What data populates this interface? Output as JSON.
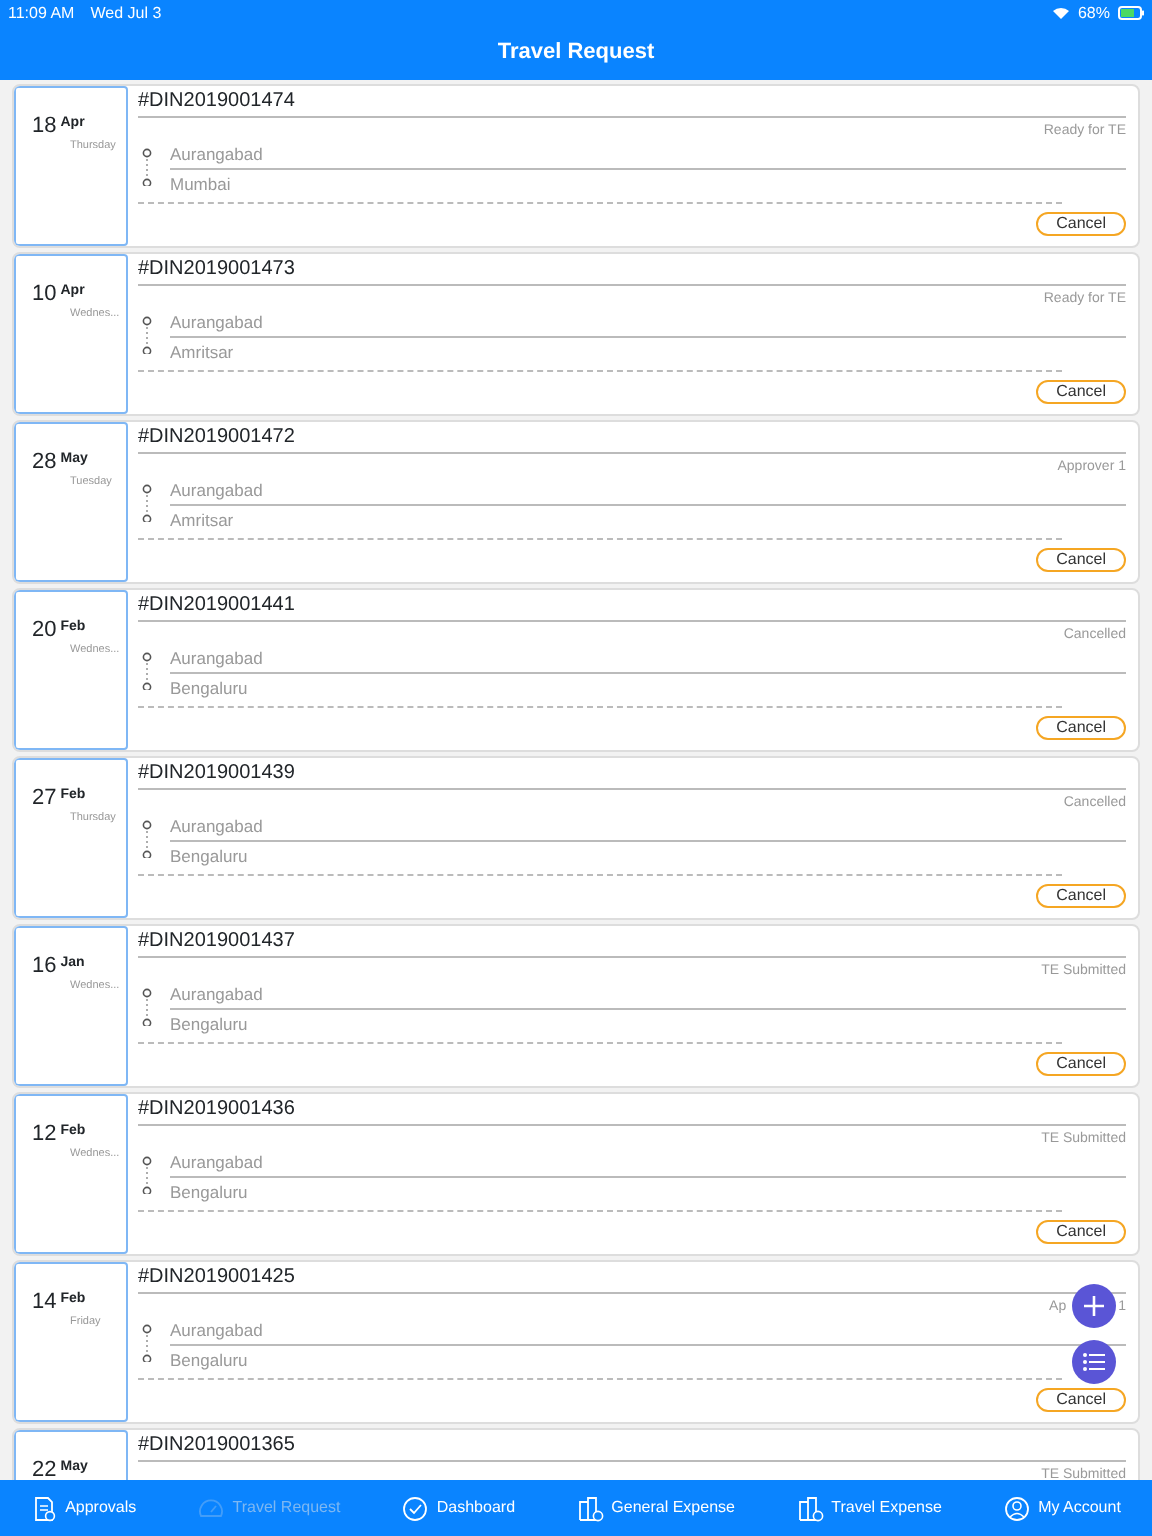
{
  "status_bar": {
    "time": "11:09 AM",
    "date": "Wed Jul 3",
    "battery": "68%"
  },
  "header": {
    "title": "Travel Request"
  },
  "requests": [
    {
      "day": "18",
      "month": "Apr",
      "weekday": "Thursday",
      "id": "#DIN2019001474",
      "status": "Ready for TE",
      "from": "Aurangabad",
      "to": "Mumbai",
      "action": "Cancel"
    },
    {
      "day": "10",
      "month": "Apr",
      "weekday": "Wednes...",
      "id": "#DIN2019001473",
      "status": "Ready for TE",
      "from": "Aurangabad",
      "to": "Amritsar",
      "action": "Cancel"
    },
    {
      "day": "28",
      "month": "May",
      "weekday": "Tuesday",
      "id": "#DIN2019001472",
      "status": "Approver 1",
      "from": "Aurangabad",
      "to": "Amritsar",
      "action": "Cancel"
    },
    {
      "day": "20",
      "month": "Feb",
      "weekday": "Wednes...",
      "id": "#DIN2019001441",
      "status": "Cancelled",
      "from": "Aurangabad",
      "to": "Bengaluru",
      "action": "Cancel"
    },
    {
      "day": "27",
      "month": "Feb",
      "weekday": "Thursday",
      "id": "#DIN2019001439",
      "status": "Cancelled",
      "from": "Aurangabad",
      "to": "Bengaluru",
      "action": "Cancel"
    },
    {
      "day": "16",
      "month": "Jan",
      "weekday": "Wednes...",
      "id": "#DIN2019001437",
      "status": "TE Submitted",
      "from": "Aurangabad",
      "to": "Bengaluru",
      "action": "Cancel"
    },
    {
      "day": "12",
      "month": "Feb",
      "weekday": "Wednes...",
      "id": "#DIN2019001436",
      "status": "TE Submitted",
      "from": "Aurangabad",
      "to": "Bengaluru",
      "action": "Cancel"
    },
    {
      "day": "14",
      "month": "Feb",
      "weekday": "Friday",
      "id": "#DIN2019001425",
      "status": "Ap",
      "status_end": "1",
      "from": "Aurangabad",
      "to": "Bengaluru",
      "action": "Cancel"
    },
    {
      "day": "22",
      "month": "May",
      "id": "#DIN2019001365",
      "status": "TE Submitted"
    }
  ],
  "tabs": [
    {
      "label": "Approvals",
      "selected": false
    },
    {
      "label": "Travel Request",
      "selected": true
    },
    {
      "label": "Dashboard",
      "selected": false
    },
    {
      "label": "General Expense",
      "selected": false
    },
    {
      "label": "Travel Expense",
      "selected": false
    },
    {
      "label": "My Account",
      "selected": false
    }
  ]
}
